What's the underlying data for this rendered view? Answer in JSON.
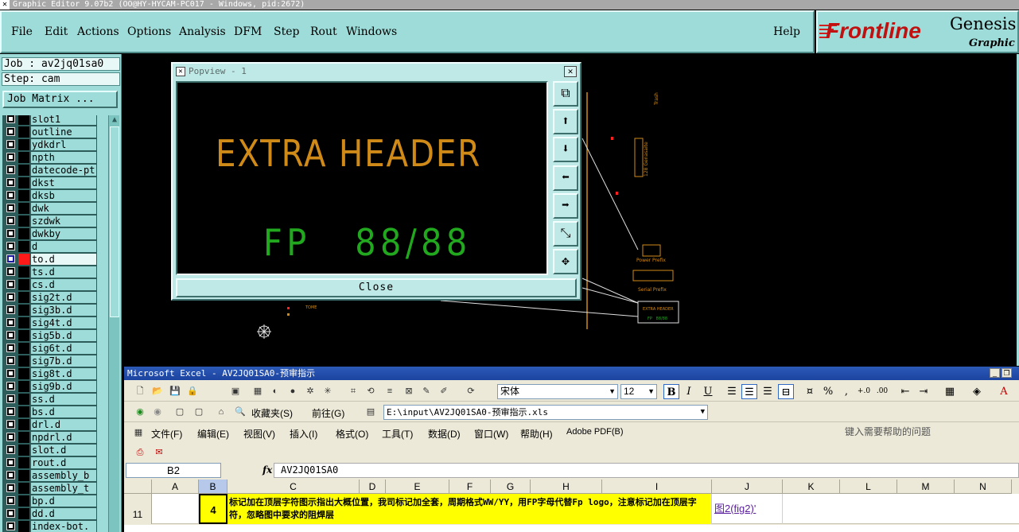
{
  "window": {
    "title": "Graphic Editor 9.07b2 (OO@HY-HYCAM-PC017 - Windows, pid:2672)"
  },
  "menubar": {
    "items": [
      "File",
      "Edit",
      "Actions",
      "Options",
      "Analysis",
      "DFM",
      "Step",
      "Rout",
      "Windows"
    ],
    "help": "Help"
  },
  "brand": {
    "frontline": "Frontline",
    "genesis": "Genesis",
    "subtitle": "Graphic Ec"
  },
  "job": {
    "job_line": "Job : av2jq01sa0",
    "step_line": "Step: cam",
    "job_matrix_label": "Job Matrix ..."
  },
  "layers": [
    {
      "name": "slot1"
    },
    {
      "name": "outline"
    },
    {
      "name": "ydkdrl"
    },
    {
      "name": "npth"
    },
    {
      "name": "datecode-pt"
    },
    {
      "name": "dkst"
    },
    {
      "name": "dksb"
    },
    {
      "name": "dwk"
    },
    {
      "name": "szdwk"
    },
    {
      "name": "dwkby"
    },
    {
      "name": "d"
    },
    {
      "name": "to.d",
      "active": true
    },
    {
      "name": "ts.d"
    },
    {
      "name": "cs.d"
    },
    {
      "name": "sig2t.d"
    },
    {
      "name": "sig3b.d"
    },
    {
      "name": "sig4t.d"
    },
    {
      "name": "sig5b.d"
    },
    {
      "name": "sig6t.d"
    },
    {
      "name": "sig7b.d"
    },
    {
      "name": "sig8t.d"
    },
    {
      "name": "sig9b.d"
    },
    {
      "name": "ss.d"
    },
    {
      "name": "bs.d"
    },
    {
      "name": "drl.d"
    },
    {
      "name": "npdrl.d"
    },
    {
      "name": "slot.d"
    },
    {
      "name": "rout.d"
    },
    {
      "name": "assembly_b"
    },
    {
      "name": "assembly_t"
    },
    {
      "name": "bp.d"
    },
    {
      "name": "dd.d"
    },
    {
      "name": "index-bot."
    }
  ],
  "canvas": {
    "labels": {
      "trash": "Trash",
      "barcode": "128 Genasaite",
      "power_prefix": "Power Prefix",
      "serial_prefix": "Serial Prefix",
      "extra_header": "EXTRA HEADER",
      "fp_small": "FP   88/88",
      "tome": "TOME"
    },
    "colors": {
      "outline": "#c8c8c8",
      "orange": "#d08a18",
      "red": "#ff2020"
    }
  },
  "popview": {
    "title": "Popview - 1",
    "line1": "EXTRA HEADER",
    "line2": "FP   88/88",
    "close_label": "Close",
    "tools": [
      "zoom-window-icon",
      "pan-up-icon",
      "pan-down-icon",
      "pan-left-icon",
      "pan-right-icon",
      "zoom-out-icon",
      "zoom-fit-icon"
    ],
    "colors": {
      "line1": "#d08a18",
      "line2": "#22a81f"
    }
  },
  "excel": {
    "title": "Microsoft Excel - AV2JQ01SA0-预审指示",
    "font_name": "宋体",
    "font_size": "12",
    "nav": {
      "favorites": "收藏夹(S)",
      "goto": "前往(G)",
      "address": "E:\\input\\AV2JQ01SA0-预审指示.xls"
    },
    "menus": [
      "文件(F)",
      "编辑(E)",
      "视图(V)",
      "插入(I)",
      "格式(O)",
      "工具(T)",
      "数据(D)",
      "窗口(W)",
      "帮助(H)",
      "Adobe PDF(B)"
    ],
    "help_placeholder": "键入需要帮助的问题",
    "name_box": "B2",
    "fx": "fx",
    "formula_value": "AV2JQ01SA0",
    "columns": [
      "A",
      "B",
      "C",
      "D",
      "E",
      "F",
      "G",
      "H",
      "I",
      "J",
      "K",
      "L",
      "M",
      "N"
    ],
    "selected_column": "B",
    "row": {
      "number": "11",
      "b": "4",
      "c": "标记加在顶层字符图示指出大概位置，我司标记加全套，周期格式WW/YY，用FP字母代替Fp logo，注意标记加在顶层字符，忽略图中要求的阻焊层",
      "j": "图2(fig2)'"
    },
    "toolbar_extra": {
      "percent": "%",
      "comma": ","
    }
  }
}
